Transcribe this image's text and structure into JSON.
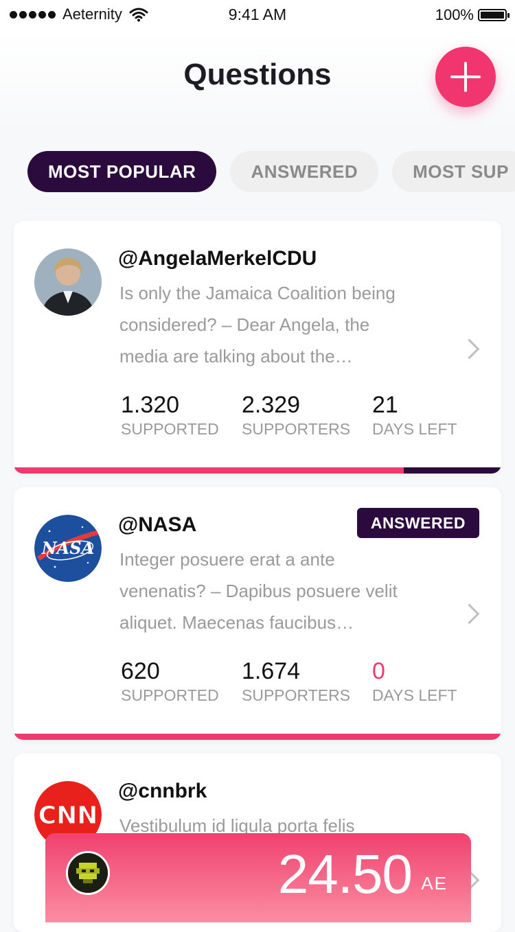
{
  "status_bar": {
    "carrier": "Aeternity",
    "time": "9:41 AM",
    "battery": "100%"
  },
  "header": {
    "title": "Questions",
    "add_icon": "plus-icon"
  },
  "tabs": [
    {
      "label": "MOST POPULAR",
      "active": true
    },
    {
      "label": "ANSWERED",
      "active": false
    },
    {
      "label": "MOST SUP",
      "active": false
    }
  ],
  "questions": [
    {
      "handle": "@AngelaMerkelCDU",
      "excerpt_lines": [
        "Is only the Jamaica Coalition being",
        "considered? – Dear Angela, the",
        "media are talking about the…"
      ],
      "stats": [
        {
          "value": "1.320",
          "label": "SUPPORTED"
        },
        {
          "value": "2.329",
          "label": "SUPPORTERS"
        },
        {
          "value": "21",
          "label": "DAYS LEFT"
        }
      ],
      "progress": 0.8,
      "answered": false
    },
    {
      "handle": "@NASA",
      "badge": "ANSWERED",
      "excerpt_lines": [
        "Integer posuere erat a ante",
        "venenatis? – Dapibus posuere velit",
        "aliquet. Maecenas faucibus…"
      ],
      "stats": [
        {
          "value": "620",
          "label": "SUPPORTED"
        },
        {
          "value": "1.674",
          "label": "SUPPORTERS"
        },
        {
          "value": "0",
          "label": "DAYS LEFT"
        }
      ],
      "progress": 1.0,
      "answered": true
    },
    {
      "handle": "@cnnbrk",
      "excerpt_lines": [
        "Vestibulum id ligula porta felis"
      ]
    }
  ],
  "balance": {
    "amount": "24.50",
    "unit": "AE"
  },
  "colors": {
    "accent": "#f0356f",
    "dark": "#2b0a3d"
  }
}
